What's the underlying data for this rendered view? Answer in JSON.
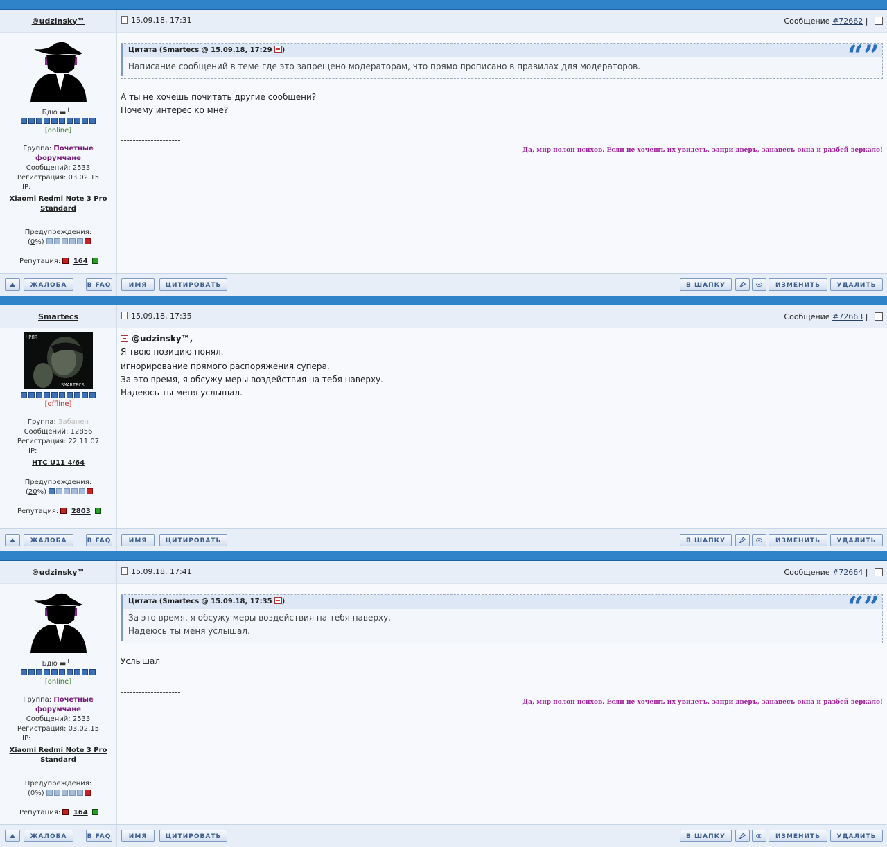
{
  "posts": [
    {
      "username": "®udzinsky™",
      "date": "15.09.18, 17:31",
      "msg_label": "Сообщение",
      "msg_no": "#72662",
      "tagline": "Бдю ▬┴─",
      "status": "[online]",
      "group_label": "Группа:",
      "group": "Почетные форумчане",
      "messages": "Сообщений: 2533",
      "registered": "Регистрация: 03.02.15",
      "ip": "IP:",
      "device": "Xiaomi Redmi Note 3 Pro Standard",
      "warn_label": "Предупреждения:",
      "warn_pre": "(",
      "warn_value": "0",
      "warn_post": "%)",
      "rep_label": "Репутация:",
      "rep_value": "164",
      "quote_title": "Цитата (Smartecs @ 15.09.18, 17:29",
      "quote_lines": [
        "Написание сообщений в теме где это запрещено модераторам, что прямо прописано в правилах для модераторов."
      ],
      "body_lines": [
        "А ты не хочешь почитать другие сообщени?",
        "Почему интерес ко мне?"
      ],
      "dashes": "--------------------",
      "signature": "Да, мир полон психов. Если не хочешъ их увидетъ, запри дверъ, занавесъ окна и разбей зеркало!"
    },
    {
      "username": "Smartecs",
      "date": "15.09.18, 17:35",
      "msg_label": "Сообщение",
      "msg_no": "#72663",
      "status": "[offline]",
      "group_label": "Группа:",
      "group": "Забанен",
      "messages": "Сообщений: 12856",
      "registered": "Регистрация: 22.11.07",
      "ip": "IP:",
      "device": "HTC U11 4/64",
      "warn_label": "Предупреждения:",
      "warn_pre": "(",
      "warn_value": "20",
      "warn_post": "%)",
      "rep_label": "Репутация:",
      "rep_value": "2803",
      "reply_to": "@udzinsky™,",
      "body_lines": [
        "Я твою позицию понял.",
        "игнорирование прямого распоряжения супера.",
        "За это время, я обсужу меры воздействия на тебя наверху.",
        "Надеюсь ты меня услышал."
      ],
      "avatar_text_top": "ЧРЯЯ",
      "avatar_text_bottom": "SMARTECS"
    },
    {
      "username": "®udzinsky™",
      "date": "15.09.18, 17:41",
      "msg_label": "Сообщение",
      "msg_no": "#72664",
      "tagline": "Бдю ▬┴─",
      "status": "[online]",
      "group_label": "Группа:",
      "group": "Почетные форумчане",
      "messages": "Сообщений: 2533",
      "registered": "Регистрация: 03.02.15",
      "ip": "IP:",
      "device": "Xiaomi Redmi Note 3 Pro Standard",
      "warn_label": "Предупреждения:",
      "warn_pre": "(",
      "warn_value": "0",
      "warn_post": "%)",
      "rep_label": "Репутация:",
      "rep_value": "164",
      "quote_title": "Цитата (Smartecs @ 15.09.18, 17:35",
      "quote_lines": [
        "За это время, я обсужу меры воздействия на тебя наверху.",
        "Надеюсь ты меня услышал."
      ],
      "body_lines": [
        "Услышал"
      ],
      "dashes": "--------------------",
      "signature": "Да, мир полон психов. Если не хочешъ их увидетъ, запри дверъ, занавесъ окна и разбей зеркало!"
    }
  ],
  "buttons": {
    "report": "ЖАЛОБА",
    "faq": "В FAQ",
    "name": "ИМЯ",
    "quote": "ЦИТИРОВАТЬ",
    "to_header": "В ШАПКУ",
    "edit": "ИЗМЕНИТЬ",
    "delete": "УДАЛИТЬ"
  },
  "icons": [
    "up-arrow-icon",
    "pin-icon",
    "eye-icon",
    "document-icon",
    "checkbox-icon",
    "quote-marks-icon",
    "back-link-icon"
  ],
  "colors": {
    "separator": "#2f83c8",
    "header_bg": "#e7eef8",
    "signature": "#a0209a",
    "group_honored": "#7a1a7a",
    "online": "#3a7a2a",
    "offline": "#cc2222"
  }
}
